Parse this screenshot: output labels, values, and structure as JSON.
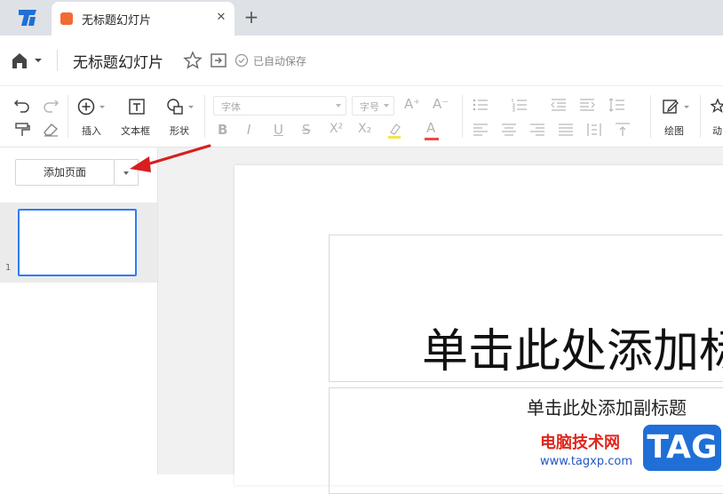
{
  "tabbar": {
    "logo_icon": "app-logo-icon",
    "tab_title": "无标题幻灯片",
    "tab_close": "✕",
    "new_tab": "+"
  },
  "titlebar": {
    "doc_title": "无标题幻灯片",
    "saved_status": "已自动保存"
  },
  "toolbar": {
    "insert_label": "插入",
    "textbox_label": "文本框",
    "shape_label": "形状",
    "font_placeholder": "字体",
    "size_placeholder": "字号",
    "bold": "B",
    "italic": "I",
    "underline": "U",
    "strike": "S",
    "superscript": "X²",
    "subscript": "X₂",
    "font_color": "A",
    "grow_font": "A⁺",
    "shrink_font": "A⁻",
    "draw_label": "绘图",
    "animation_label": "动"
  },
  "sidebar": {
    "add_page_label": "添加页面",
    "slides": [
      {
        "number": "1"
      }
    ]
  },
  "slide": {
    "title_placeholder": "单击此处添加标",
    "subtitle_placeholder": "单击此处添加副标题"
  },
  "watermark": {
    "site_name": "电脑技术网",
    "url": "www.tagxp.com",
    "badge": "TAG"
  },
  "colors": {
    "accent": "#2f7cf6",
    "annotation_arrow": "#d81e1e",
    "tab_icon": "#f26b34"
  }
}
